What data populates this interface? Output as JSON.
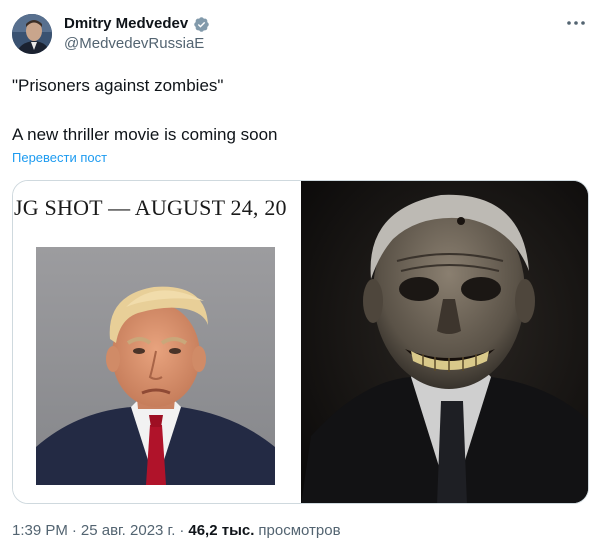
{
  "author": {
    "display_name": "Dmitry Medvedev",
    "handle": "@MedvedevRussiaE",
    "verified": true
  },
  "post": {
    "line1": "\"Prisoners against zombies\"",
    "line2": "A new thriller movie is coming soon",
    "translate_label": "Перевести пост"
  },
  "media": {
    "left_header_text": "JG SHOT — AUGUST 24, 20"
  },
  "meta": {
    "time": "1:39 PM",
    "date": "25 авг. 2023 г.",
    "views_count": "46,2 тыс.",
    "views_label": "просмотров",
    "separator": "·"
  },
  "colors": {
    "link_blue": "#1d9bf0",
    "secondary_text": "#536471",
    "primary_text": "#0f1419",
    "border": "#cfd9de",
    "verified_gray": "#829aab"
  }
}
